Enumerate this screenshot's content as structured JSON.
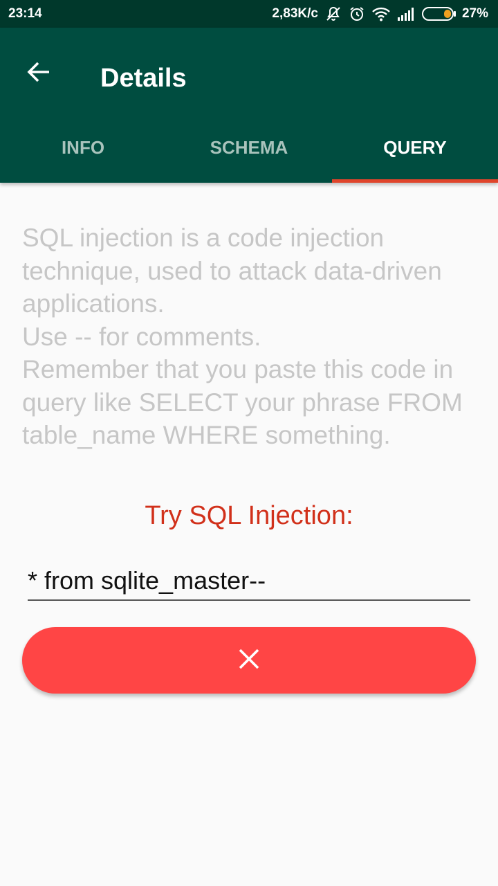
{
  "status_bar": {
    "time": "23:14",
    "network_speed": "2,83K/c",
    "battery": "27%",
    "icons": [
      "bell-muted-icon",
      "alarm-icon",
      "wifi-icon",
      "signal-icon",
      "battery-icon"
    ]
  },
  "app_bar": {
    "back_icon": "arrow-left-icon",
    "title": "Details",
    "background": "#004d40"
  },
  "tabs": [
    {
      "label": "INFO",
      "active": false
    },
    {
      "label": "SCHEMA",
      "active": false
    },
    {
      "label": "QUERY",
      "active": true
    }
  ],
  "colors": {
    "accent": "#e0452b",
    "button": "#ff4545"
  },
  "query": {
    "description": "SQL injection is a code injection technique, used to attack data-driven applications.\n Use -- for comments.\n Remember that you paste this code in query like SELECT your phrase FROM table_name WHERE something.",
    "try_label": "Try SQL Injection:",
    "input_value": "* from sqlite_master--",
    "button_icon": "close-icon"
  }
}
